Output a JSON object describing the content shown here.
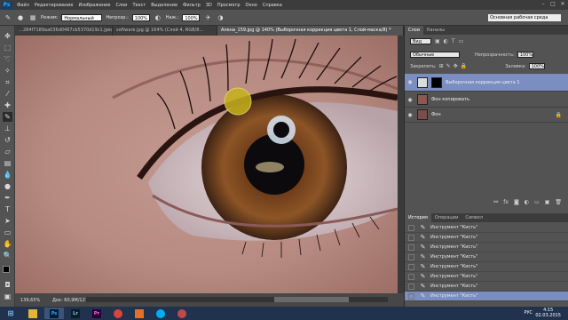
{
  "menu": [
    "Файл",
    "Редактирование",
    "Изображение",
    "Слои",
    "Текст",
    "Выделение",
    "Фильтр",
    "3D",
    "Просмотр",
    "Окно",
    "Справка"
  ],
  "app_logo": "Ps",
  "options": {
    "mode_label": "Режим:",
    "mode_value": "Нормальный",
    "opacity_label": "Непрозр.:",
    "opacity_value": "100%",
    "press_label": "Наж.:",
    "press_value": "100%",
    "workspace": "Основная рабочая среда"
  },
  "tabs": [
    {
      "label": "…284f7189aa036d0467cb5370d19c1.jpeg",
      "active": false
    },
    {
      "label": "software.jpg @ 164% (Слой 4, RGB/8…",
      "active": false
    },
    {
      "label": "Алена_159.jpg @ 140% (Выборочная коррекция цвета 1, Слой-маска/8) *",
      "active": true
    }
  ],
  "status": {
    "zoom": "139,65%",
    "doc": "Док: 60,9M/127,6M"
  },
  "layers_panel": {
    "tabs": [
      "Слои",
      "Каналы"
    ],
    "kind": "Вид",
    "blend": "Обычные",
    "opacity_label": "Непрозрачность:",
    "opacity_value": "100%",
    "lock_label": "Закрепить:",
    "fill_label": "Заливка:",
    "fill_value": "100%",
    "layers": [
      {
        "name": "Выборочная коррекция цвета 1",
        "selected": true
      },
      {
        "name": "Фон копировать",
        "selected": false
      },
      {
        "name": "Фон",
        "selected": false
      }
    ]
  },
  "history_panel": {
    "tabs": [
      "История",
      "Операции",
      "Символ"
    ],
    "items": [
      "Инструмент \"Кисть\"",
      "Инструмент \"Кисть\"",
      "Инструмент \"Кисть\"",
      "Инструмент \"Кисть\"",
      "Инструмент \"Кисть\"",
      "Инструмент \"Кисть\"",
      "Инструмент \"Кисть\"",
      "Инструмент \"Кисть\""
    ]
  },
  "taskbar": {
    "apps": [
      "Explorer",
      "Ps",
      "Lr",
      "Pr",
      "Chrome",
      "Opera",
      "Skype",
      "Tool"
    ],
    "lang": "РУС",
    "time": "4:15",
    "date": "02.03.2015"
  },
  "colors": {
    "accent": "#7b8ec2",
    "ps_blue": "#31a8ff"
  }
}
